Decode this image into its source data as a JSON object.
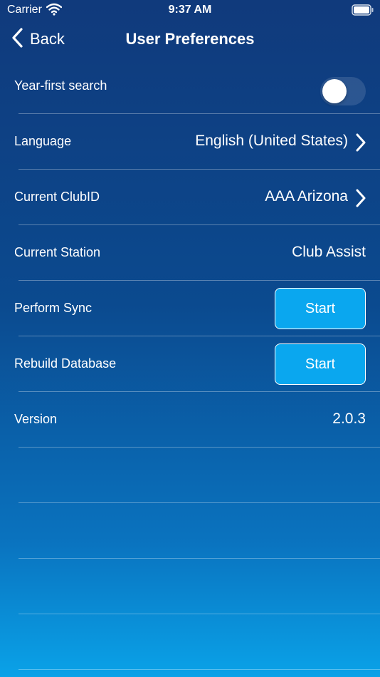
{
  "status_bar": {
    "carrier": "Carrier",
    "time": "9:37 AM",
    "wifi_icon": "wifi-icon",
    "battery_icon": "battery-icon"
  },
  "nav": {
    "back_label": "Back",
    "title": "User Preferences"
  },
  "settings": {
    "year_first_search": {
      "label": "Year-first search",
      "enabled": false
    },
    "language": {
      "label": "Language",
      "value": "English (United States)"
    },
    "club": {
      "label": "Current ClubID",
      "value": "AAA Arizona"
    },
    "station": {
      "label": "Current Station",
      "value": "Club Assist"
    },
    "sync": {
      "label": "Perform Sync",
      "button": "Start"
    },
    "rebuild": {
      "label": "Rebuild Database",
      "button": "Start"
    },
    "version": {
      "label": "Version",
      "value": "2.0.3"
    }
  },
  "colors": {
    "button_fill": "#0aa7ef",
    "gradient_top": "#103a7c",
    "gradient_bottom": "#0aa2e8"
  }
}
